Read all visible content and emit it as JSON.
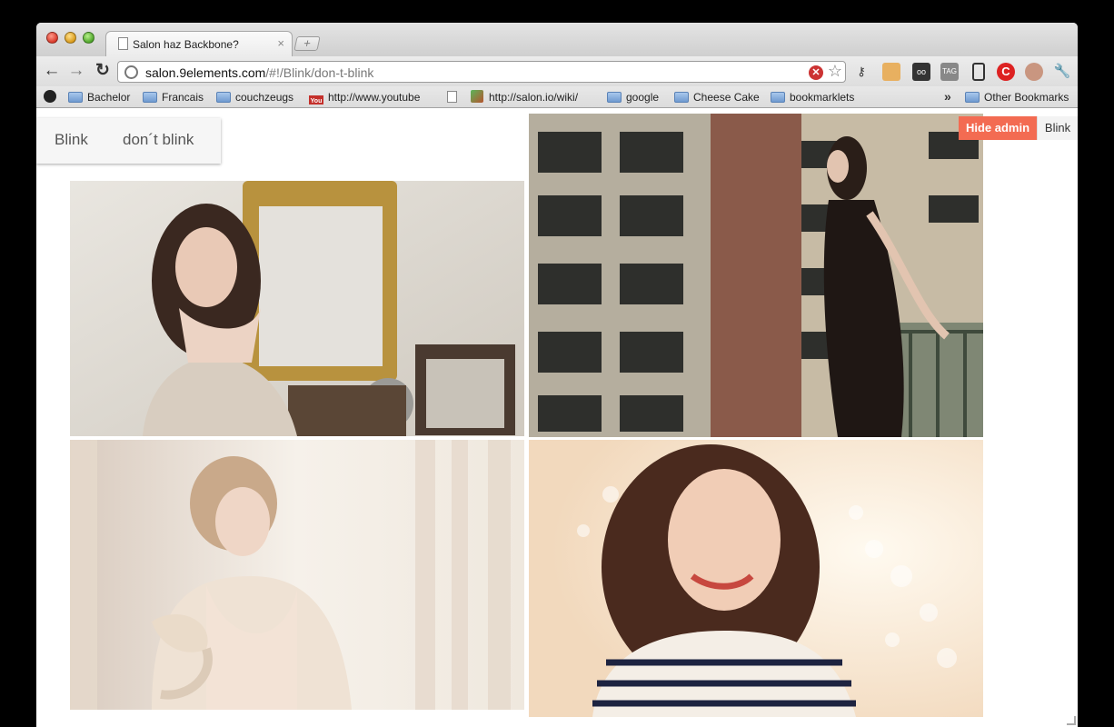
{
  "browser": {
    "tab": {
      "title": "Salon haz Backbone?",
      "close": "×"
    },
    "new_tab": "+",
    "nav": {
      "back": "←",
      "forward": "→",
      "reload": "↻"
    },
    "omnibox": {
      "host": "salon.9elements.com",
      "path": "/#!/Blink/don-t-blink"
    },
    "bookmarks": [
      {
        "label": "Bachelor",
        "kind": "folder"
      },
      {
        "label": "Francais",
        "kind": "folder"
      },
      {
        "label": "couchzeugs",
        "kind": "folder"
      },
      {
        "label": "http://www.youtube",
        "kind": "youtube"
      },
      {
        "label": "",
        "kind": "page"
      },
      {
        "label": "http://salon.io/wiki/",
        "kind": "page-leaf"
      },
      {
        "label": "google",
        "kind": "folder"
      },
      {
        "label": "Cheese Cake",
        "kind": "folder"
      },
      {
        "label": "bookmarklets",
        "kind": "folder"
      }
    ],
    "more_chevron": "»",
    "other_bookmarks": "Other Bookmarks",
    "extensions": [
      "key-icon",
      "cake-icon",
      "glasses-icon",
      "tag-icon",
      "phone-icon",
      "stop-icon",
      "apple-icon",
      "wrench-icon"
    ]
  },
  "page": {
    "title": {
      "main": "Blink",
      "sub": "don´t blink"
    },
    "admin": {
      "button": "Hide admin",
      "label": "Blink"
    },
    "photos": [
      {
        "name": "photo-woman-mirror"
      },
      {
        "name": "photo-woman-balcony"
      },
      {
        "name": "photo-woman-bow"
      },
      {
        "name": "photo-woman-striped-shirt"
      }
    ]
  },
  "colors": {
    "admin_accent": "#f36b52"
  }
}
